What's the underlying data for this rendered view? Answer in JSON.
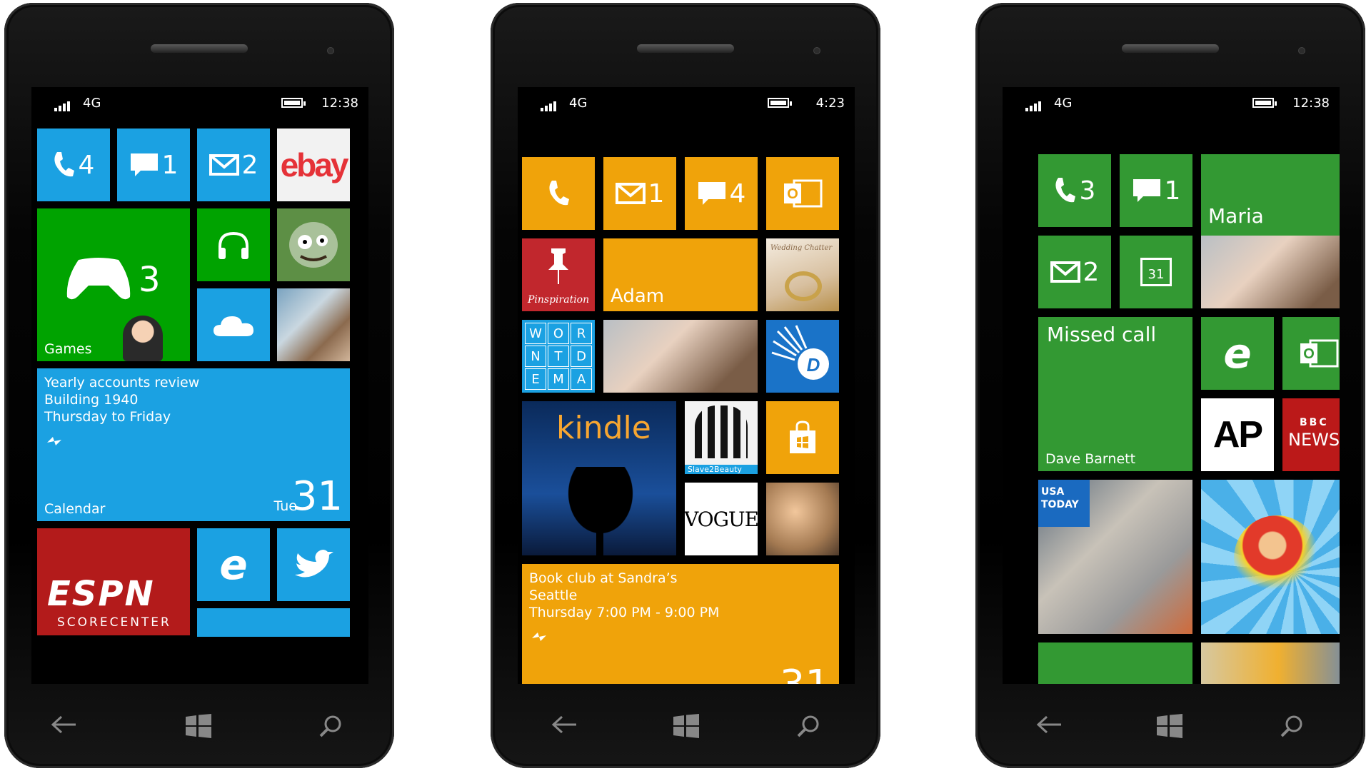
{
  "phones": [
    {
      "status": {
        "network": "4G",
        "time": "12:38"
      },
      "tiles": {
        "phone_count": "4",
        "messages_count": "1",
        "mail_count": "2",
        "ebay_logo": "ebay",
        "games_count": "3",
        "games_label": "Games",
        "calendar_lines": [
          "Yearly accounts review",
          "Building 1940",
          "Thursday to Friday"
        ],
        "calendar_label": "Calendar",
        "calendar_day": "Tue",
        "calendar_date": "31",
        "espn_logo": "ESPN",
        "espn_sub": "SCORECENTER"
      },
      "accent": "#1ba1e2"
    },
    {
      "status": {
        "network": "4G",
        "time": "4:23"
      },
      "tiles": {
        "mail_count": "1",
        "messages_count": "4",
        "pinspiration_label": "Pinspiration",
        "contact_name": "Adam",
        "wedding_label": "Wedding Chatter",
        "wordament_letters": [
          "W",
          "O",
          "R",
          "N",
          "T",
          "D",
          "E",
          "M",
          "A"
        ],
        "kindle_label": "kindle",
        "slave2beauty_label": "Slave2Beauty",
        "vogue_label": "VOGUE",
        "calendar_lines": [
          "Book club at Sandra’s",
          "Seattle",
          "Thursday 7:00 PM - 9:00 PM"
        ],
        "calendar_date_partial": "31"
      },
      "accent": "#f0a30a"
    },
    {
      "status": {
        "network": "4G",
        "time": "12:38"
      },
      "tiles": {
        "phone_count": "3",
        "messages_count": "1",
        "contact_name": "Maria",
        "mail_count": "2",
        "calendar_icon_day": "31",
        "missed_call_title": "Missed call",
        "missed_call_name": "Dave Barnett",
        "ap_logo": "AP",
        "bbc_top": "BBC",
        "bbc_bottom": "NEWS",
        "usa_today_logo": "USA TODAY"
      },
      "accent": "#339933"
    }
  ]
}
